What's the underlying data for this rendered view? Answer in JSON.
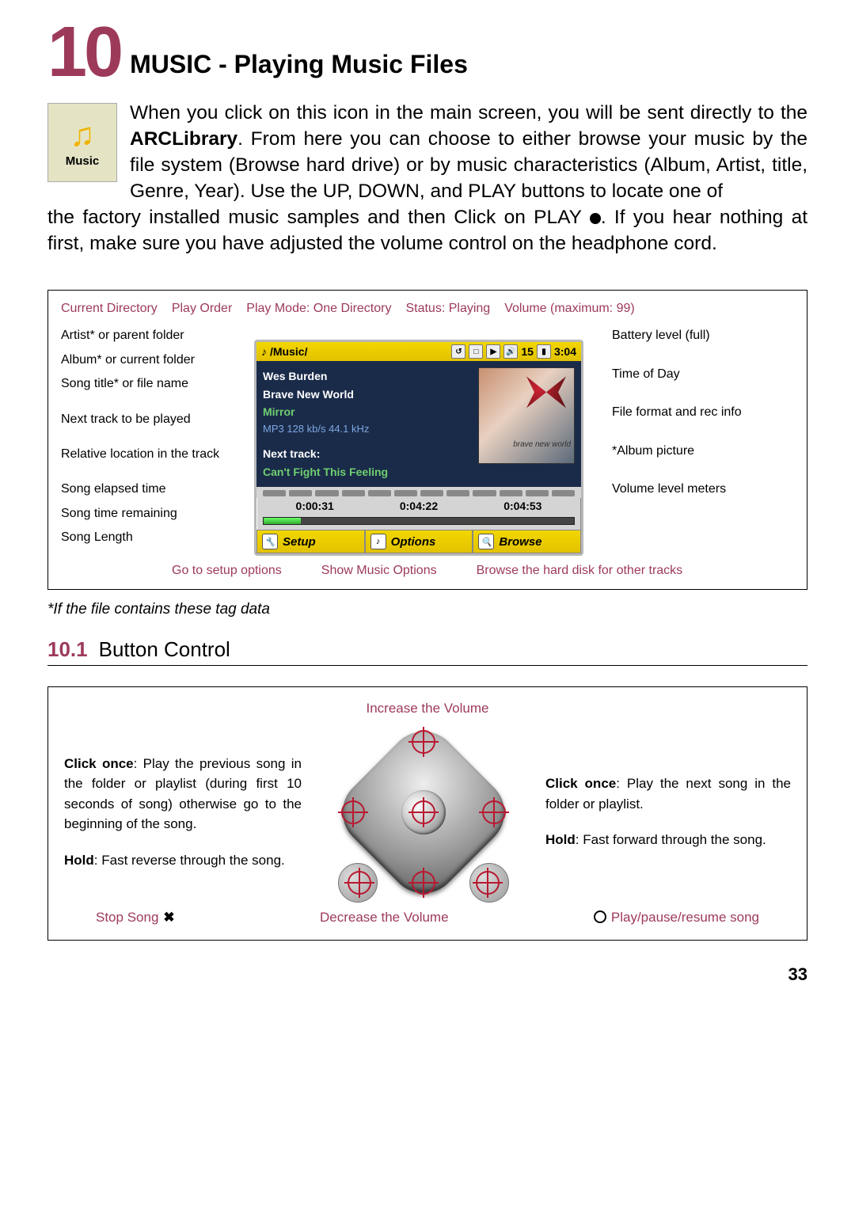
{
  "chapter": {
    "number": "10",
    "title": "MUSIC - Playing Music Files"
  },
  "music_icon_label": "Music",
  "intro_first": "When you click on this icon in the main screen, you will be sent directly to the <b>ARCLibrary</b>. From here you can choose to either browse your music by the file system (Browse hard drive) or by music characteristics (Album, Artist, title, Genre, Year). Use the UP, DOWN, and PLAY buttons to locate one of",
  "intro_rest": "the factory installed music samples and then Click on PLAY <span class='play-icon'></span>. If you hear nothing at first, make sure you have adjusted the volume control on the headphone cord.",
  "diag1": {
    "top": {
      "curdir": "Current Directory",
      "playorder": "Play Order",
      "playmode": "Play Mode: One Directory",
      "status": "Status: Playing",
      "volume": "Volume (maximum: 99)"
    },
    "left": {
      "artist": "Artist* or parent folder",
      "album": "Album* or current folder",
      "title": "Song title* or file name",
      "next": "Next track to be played",
      "loc": "Relative location in the track",
      "elapsed": "Song elapsed time",
      "remain": "Song time remaining",
      "length": "Song Length"
    },
    "right": {
      "battery": "Battery level (full)",
      "time": "Time of Day",
      "format": "File format and rec info",
      "art": "*Album picture",
      "meters": "Volume level meters"
    },
    "player": {
      "path": "/Music/",
      "vol_icon": "15",
      "clock": "3:04",
      "artist": "Wes Burden",
      "album": "Brave New World",
      "title": "Mirror",
      "codec": "MP3 128 kb/s 44.1 kHz",
      "next_label": "Next track:",
      "next_track": "Can't Fight This Feeling",
      "t_elapsed": "0:00:31",
      "t_remain": "0:04:22",
      "t_length": "0:04:53",
      "tab_setup": "Setup",
      "tab_options": "Options",
      "tab_browse": "Browse"
    },
    "bottom": {
      "setup": "Go to setup options",
      "options": "Show Music Options",
      "browse": "Browse the hard disk for other tracks"
    },
    "footnote": "*If the file contains these tag data"
  },
  "section": {
    "num": "10.1",
    "title": "Button Control"
  },
  "diag2": {
    "top": "Increase the Volume",
    "left1_bold": "Click once",
    "left1": ": Play the previous song in the folder or playlist (during first 10 seconds of song) otherwise go to the beginning of the song.",
    "left2_bold": "Hold",
    "left2": ": Fast reverse through the song.",
    "right1_bold": "Click once",
    "right1": ": Play the next song in the folder or playlist.",
    "right2_bold": "Hold",
    "right2": ": Fast forward through the song.",
    "bottom": {
      "stop": "Stop Song",
      "dec": "Decrease the Volume",
      "play": "Play/pause/resume song"
    }
  },
  "page_number": "33"
}
